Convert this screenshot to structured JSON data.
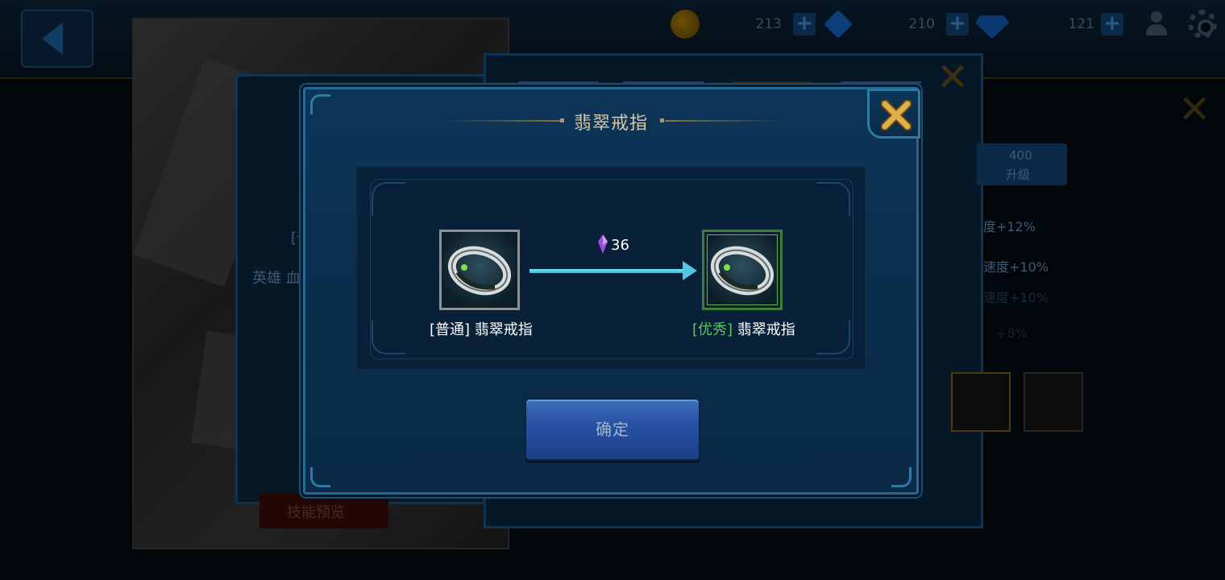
{
  "resources": {
    "gold": "213",
    "crystal": "210",
    "diamond": "121"
  },
  "background": {
    "hero_quality_prefix": "[普",
    "hero_text": "英雄 血",
    "upgrade_cost": "400",
    "upgrade_label": "升級",
    "stat_1": "度+12%",
    "stat_2": "速度+10%",
    "stat_3": "速度+10%",
    "stat_4": "+8%",
    "skill_preview": "技能预览"
  },
  "dialog": {
    "title": "翡翠戒指",
    "source_item": {
      "quality": "[普通]",
      "name": "翡翠戒指",
      "quality_color": "#ffffff"
    },
    "target_item": {
      "quality": "[优秀]",
      "name": "翡翠戒指",
      "quality_color": "#5bc95b"
    },
    "cost": "36",
    "cost_icon": "purple-crystal-icon",
    "confirm_label": "确定"
  },
  "colors": {
    "accent_blue": "#2d7aa6",
    "arrow_cyan": "#54c6df",
    "title_gold": "#d7c7a6",
    "close_gold": "#d9a73e"
  }
}
